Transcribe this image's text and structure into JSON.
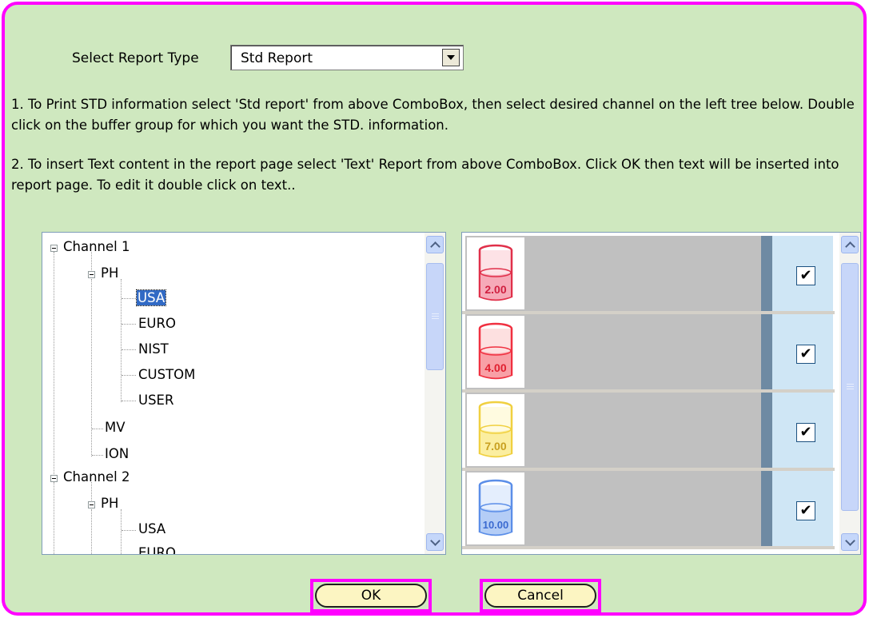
{
  "report_type": {
    "label": "Select Report Type",
    "selected": "Std Report"
  },
  "instructions": {
    "line1": "1. To Print STD information select 'Std report' from above ComboBox, then select desired channel on the left tree below. Double click on the buffer group for which you want the STD. information.",
    "line2": "2. To insert Text content in the report page select 'Text' Report from above ComboBox. Click OK then text will be inserted into report page. To edit it double click on text.."
  },
  "tree": {
    "channel1": "Channel 1",
    "ph1": "PH",
    "usa1": "USA",
    "euro1": "EURO",
    "nist1": "NIST",
    "custom1": "CUSTOM",
    "user1": "USER",
    "mv1": "MV",
    "ion1": "ION",
    "channel2": "Channel 2",
    "ph2": "PH",
    "usa2": "USA",
    "euro2": "EURO"
  },
  "buffers": [
    {
      "value": "2.00",
      "color": "#e0304a",
      "checked": true
    },
    {
      "value": "4.00",
      "color": "#f03040",
      "checked": true
    },
    {
      "value": "7.00",
      "color": "#f0d040",
      "checked": true
    },
    {
      "value": "10.00",
      "color": "#5b8ee8",
      "checked": true
    }
  ],
  "check_mark": "✔",
  "buttons": {
    "ok": "OK",
    "cancel": "Cancel"
  },
  "colors": {
    "background": "#cfe8bf",
    "frame": "#ff00ff",
    "selection": "#316ac5"
  }
}
